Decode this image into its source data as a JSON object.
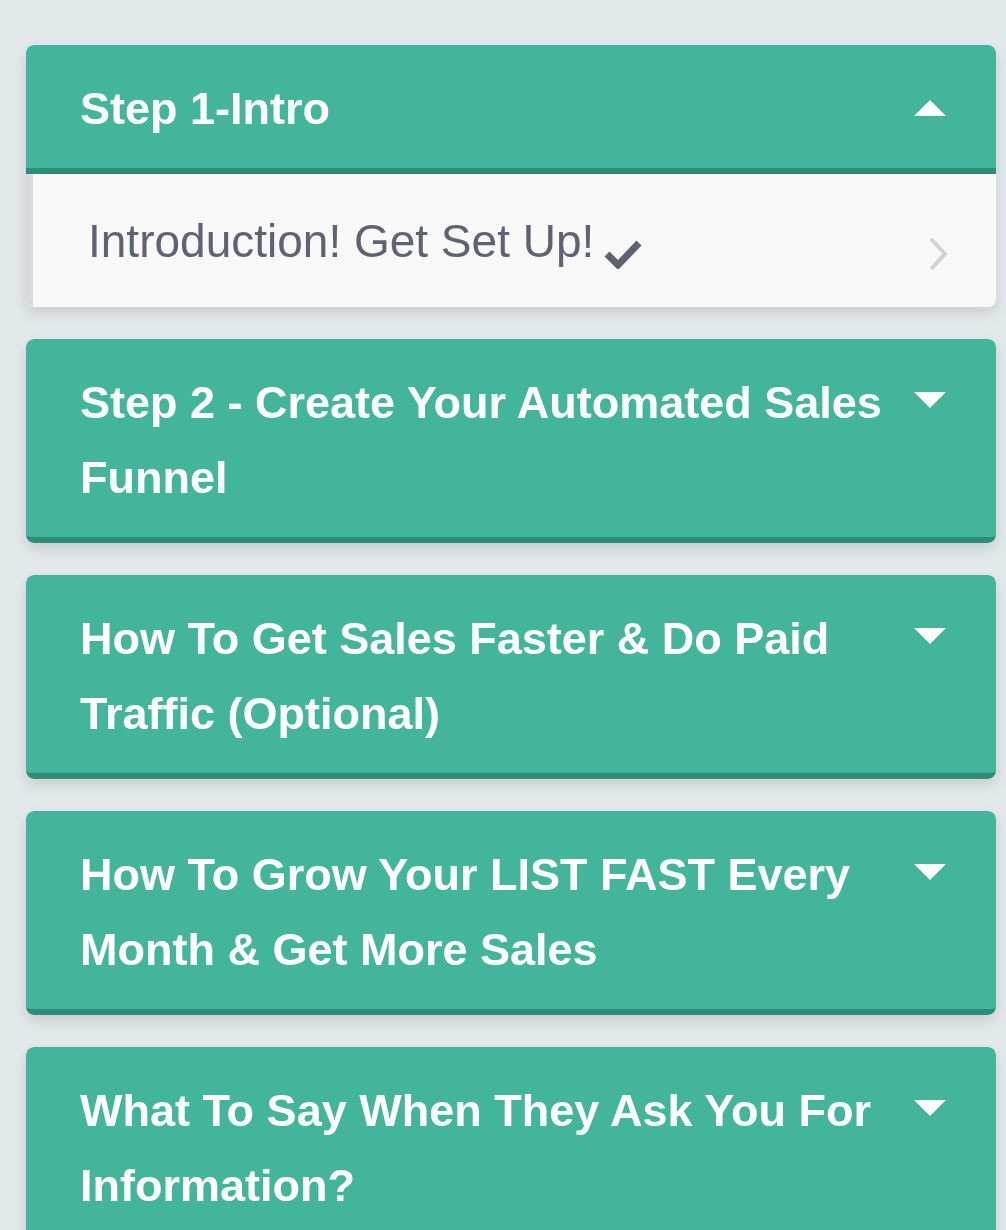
{
  "sections": [
    {
      "title": "Step 1-Intro",
      "expanded": true,
      "lessons": [
        {
          "title": "Introduction! Get Set Up!",
          "completed": true
        }
      ]
    },
    {
      "title": "Step 2 - Create Your Automated Sales Funnel",
      "expanded": false
    },
    {
      "title": "How To Get Sales Faster & Do Paid Traffic (Optional)",
      "expanded": false
    },
    {
      "title": "How To Grow Your LIST FAST Every Month & Get More Sales",
      "expanded": false
    },
    {
      "title": "What To Say When They Ask You For Information?",
      "expanded": false
    }
  ]
}
